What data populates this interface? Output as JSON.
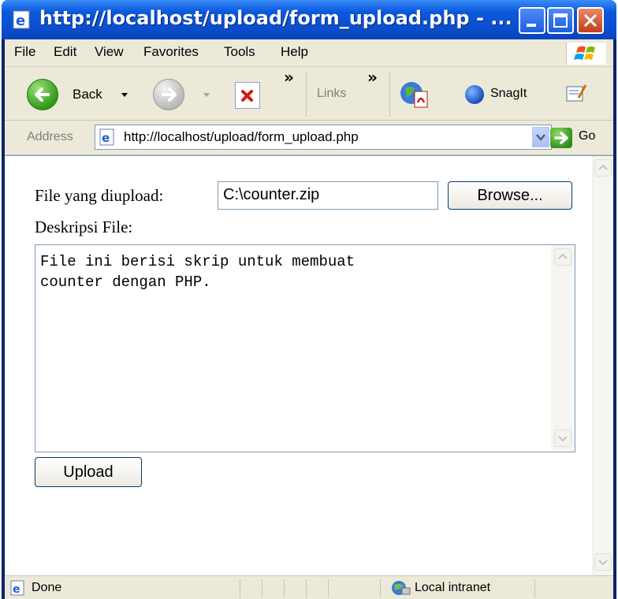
{
  "window": {
    "title": "http://localhost/upload/form_upload.php - ..."
  },
  "menu": {
    "items": [
      "File",
      "Edit",
      "View",
      "Favorites",
      "Tools",
      "Help"
    ]
  },
  "toolbar": {
    "back_label": "Back",
    "links_label": "Links",
    "snagit_label": "SnagIt"
  },
  "address": {
    "label": "Address",
    "url": "http://localhost/upload/form_upload.php",
    "go_label": "Go"
  },
  "form": {
    "file_label": "File yang diupload:",
    "file_value": "C:\\counter.zip",
    "browse_label": "Browse...",
    "desc_label": "Deskripsi File:",
    "desc_value": "File ini berisi skrip untuk membuat\ncounter dengan PHP.",
    "upload_label": "Upload"
  },
  "status": {
    "text": "Done",
    "zone": "Local intranet"
  },
  "icons": {
    "page": "ie-page-icon",
    "back": "back-arrow-icon",
    "forward": "forward-arrow-icon",
    "stop": "stop-icon",
    "pdf": "pdf-icon",
    "snagit": "snagit-icon",
    "edit": "edit-icon",
    "go": "go-arrow-icon",
    "intranet": "local-intranet-icon"
  },
  "colors": {
    "titlebar": "#0a58dc",
    "close": "#c13f1a",
    "chrome": "#ece9d8",
    "input_border": "#7f9db9"
  }
}
